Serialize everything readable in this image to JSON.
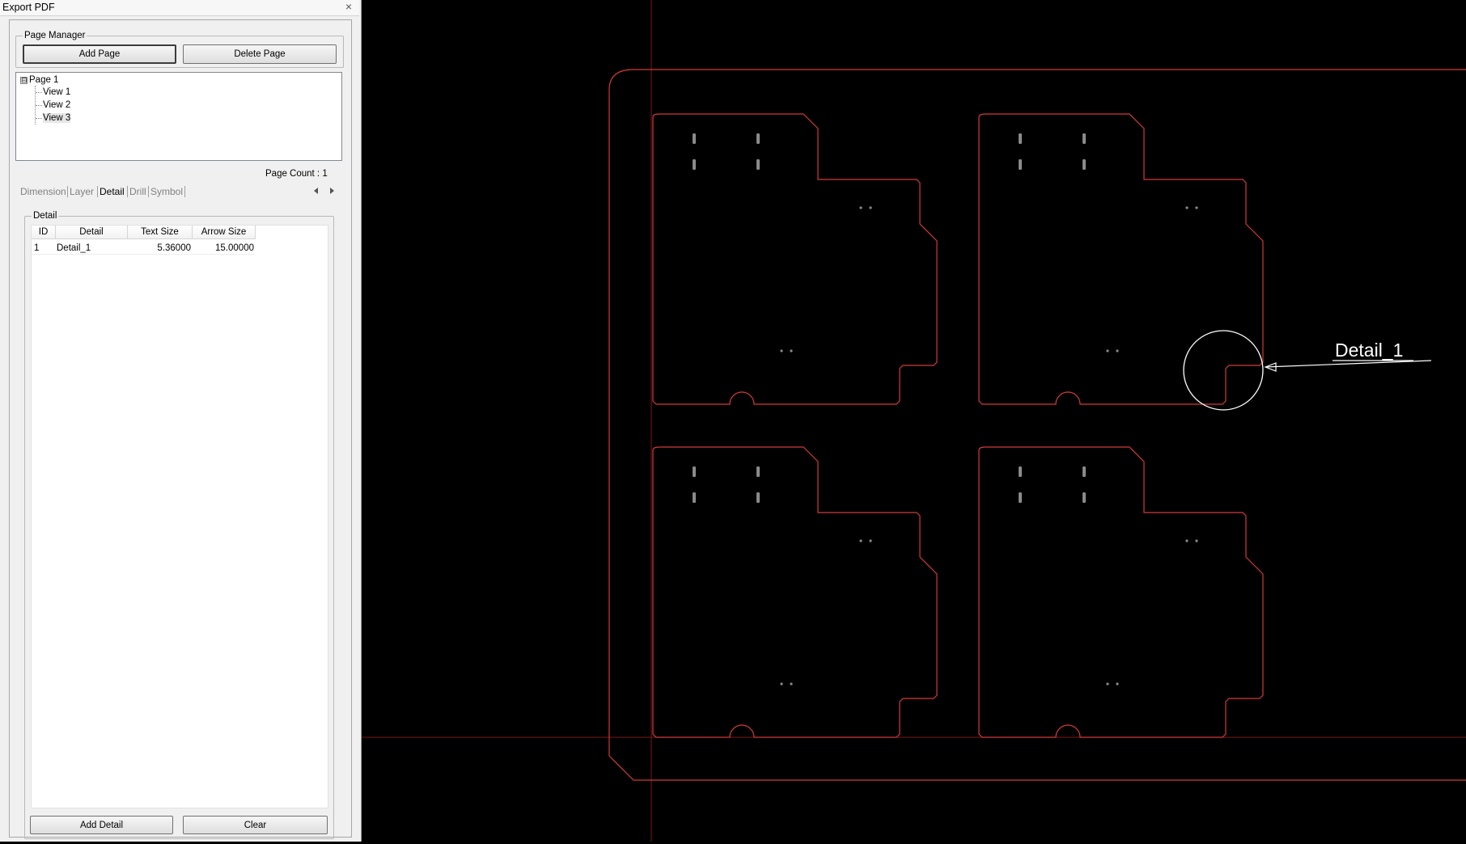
{
  "window": {
    "title": "Export PDF",
    "close_glyph": "×"
  },
  "page_manager": {
    "legend": "Page Manager",
    "add_page_label": "Add Page",
    "delete_page_label": "Delete Page"
  },
  "tree": {
    "expander_glyph": "⊟",
    "root": "Page 1",
    "children": [
      "View 1",
      "View 2",
      "View 3"
    ],
    "selected": "View 3"
  },
  "page_count": "Page Count : 1",
  "tabs": [
    "Dimension",
    "Layer",
    "Detail",
    "Drill",
    "Symbol"
  ],
  "active_tab": "Detail",
  "detail": {
    "legend": "Detail",
    "columns": [
      "ID",
      "Detail",
      "Text Size",
      "Arrow Size"
    ],
    "rows": [
      {
        "id": "1",
        "detail": "Detail_1",
        "text_size": "5.36000",
        "arrow_size": "15.00000"
      }
    ],
    "add_detail_label": "Add Detail",
    "clear_label": "Clear"
  },
  "canvas": {
    "detail_label": "Detail_1",
    "outline_color": "#d23a3a",
    "axis_color": "#7a1717",
    "annotation_color": "#ffffff",
    "feature_color": "#8a8a8a"
  }
}
